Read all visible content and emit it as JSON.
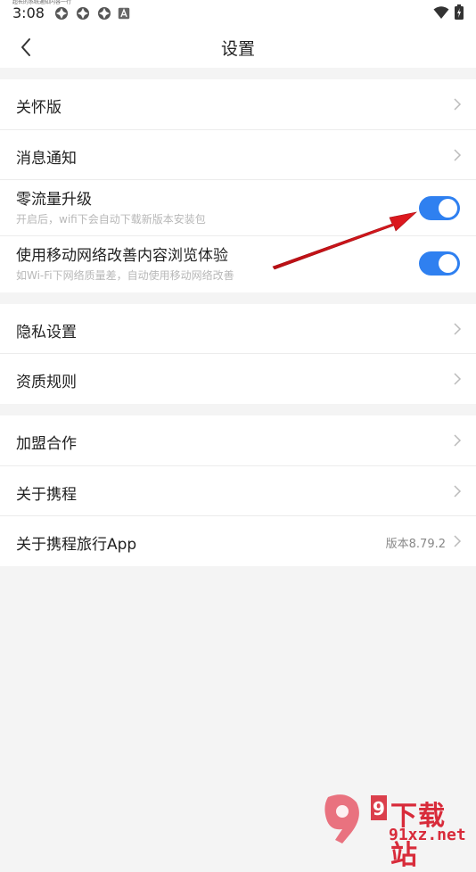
{
  "status_bar": {
    "time": "3:08",
    "tiny_text": "超长的系统通知内容一行",
    "icons": [
      "app-notification-icon",
      "app-notification-icon",
      "app-notification-icon",
      "a-badge-icon"
    ],
    "right_icons": [
      "wifi-icon",
      "battery-icon"
    ]
  },
  "nav": {
    "title": "设置",
    "back_icon": "chevron-left-icon"
  },
  "group1": {
    "items": [
      {
        "label": "关怀版"
      },
      {
        "label": "消息通知"
      }
    ],
    "toggles": [
      {
        "label": "零流量升级",
        "sub": "开启后，wifi下会自动下载新版本安装包",
        "on": true
      },
      {
        "label": "使用移动网络改善内容浏览体验",
        "sub": "如Wi-Fi下网络质量差，自动使用移动网络改善",
        "on": true
      }
    ]
  },
  "group2": {
    "items": [
      {
        "label": "隐私设置"
      },
      {
        "label": "资质规则"
      }
    ]
  },
  "group3": {
    "items": [
      {
        "label": "加盟合作"
      },
      {
        "label": "关于携程"
      },
      {
        "label": "关于携程旅行App",
        "value": "版本8.79.2"
      }
    ]
  },
  "watermark": {
    "text_top": "下载站",
    "text_bottom": "91xz.net",
    "logo_text": "9"
  },
  "colors": {
    "accent": "#2f80f0",
    "background": "#f4f4f4",
    "arrow": "#d9141b"
  }
}
